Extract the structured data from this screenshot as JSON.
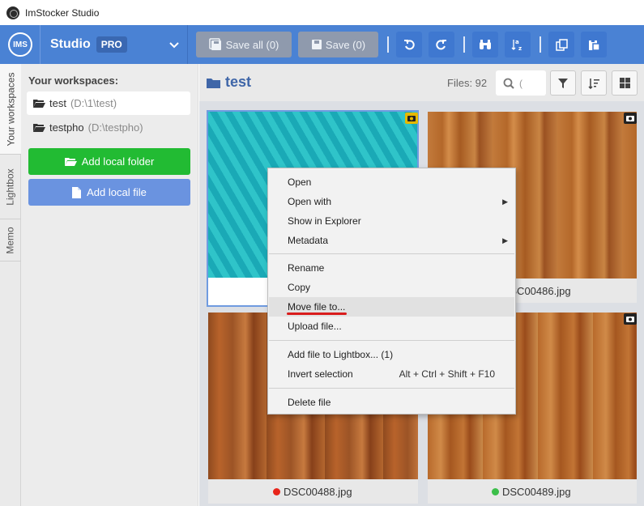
{
  "app": {
    "title": "ImStocker Studio"
  },
  "header": {
    "logo_text": "IMS",
    "studio": "Studio",
    "badge": "PRO",
    "save_all": "Save all (0)",
    "save": "Save (0)"
  },
  "side_tabs": [
    "Your workspaces",
    "Lightbox",
    "Memo"
  ],
  "left": {
    "title": "Your workspaces:",
    "workspaces": [
      {
        "name": "test",
        "path": "(D:\\1\\test)"
      },
      {
        "name": "testpho",
        "path": "(D:\\testpho)"
      }
    ],
    "add_folder": "Add local folder",
    "add_file": "Add local file"
  },
  "main": {
    "folder": "test",
    "files_label": "Files: 92",
    "search_placeholder": "(",
    "captions": [
      "",
      "DSC00486.jpg",
      "DSC00488.jpg",
      "DSC00489.jpg"
    ],
    "caption_dot_colors": [
      "",
      "",
      "#e8251b",
      "#3cbf4a"
    ]
  },
  "context_menu": {
    "items": [
      {
        "label": "Open",
        "shortcut": "",
        "submenu": false
      },
      {
        "label": "Open with",
        "shortcut": "",
        "submenu": true
      },
      {
        "label": "Show in Explorer",
        "shortcut": "",
        "submenu": false
      },
      {
        "label": "Metadata",
        "shortcut": "",
        "submenu": true
      },
      {
        "label": "Rename",
        "shortcut": "",
        "submenu": false
      },
      {
        "label": "Copy",
        "shortcut": "",
        "submenu": false
      },
      {
        "label": "Move file to...",
        "shortcut": "",
        "submenu": false
      },
      {
        "label": "Upload file...",
        "shortcut": "",
        "submenu": false
      },
      {
        "label": "Add file to Lightbox... (1)",
        "shortcut": "",
        "submenu": false
      },
      {
        "label": "Invert selection",
        "shortcut": "Alt + Ctrl + Shift + F10",
        "submenu": false
      },
      {
        "label": "Delete file",
        "shortcut": "",
        "submenu": false
      }
    ],
    "highlighted": "Move file to..."
  },
  "colors": {
    "header_blue": "#4a82d4",
    "green_button": "#22bb33",
    "annotation_red": "#d91c1c"
  }
}
